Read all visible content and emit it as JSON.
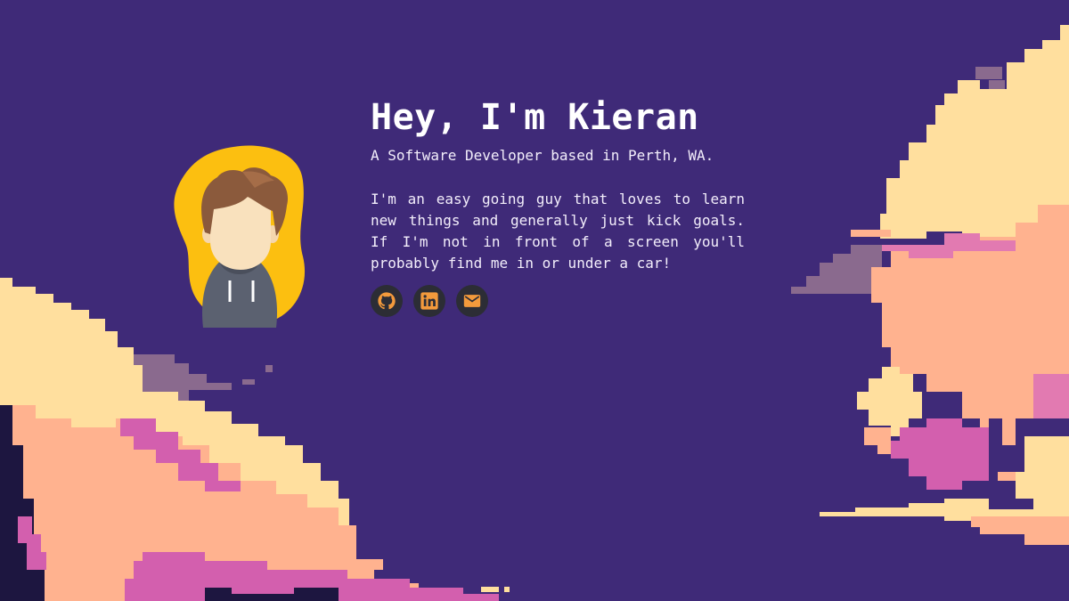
{
  "hero": {
    "title": "Hey, I'm Kieran",
    "subtitle": "A Software Developer based in Perth, WA.",
    "bio": "I'm an easy going guy that loves to learn new things and generally just kick goals. If I'm not in front of a screen you'll probably find me in or under a car!"
  },
  "socials": [
    {
      "name": "github",
      "icon": "github-icon"
    },
    {
      "name": "linkedin",
      "icon": "linkedin-icon"
    },
    {
      "name": "email",
      "icon": "mail-icon"
    }
  ],
  "avatar": {
    "icon": "developer-avatar"
  },
  "colors": {
    "background": "#3f2a78",
    "cloud_light": "#ffdf9e",
    "cloud_peach": "#ffb28f",
    "cloud_pink": "#d35fae",
    "cloud_mauve": "#8a6a8e",
    "social_bg": "#2c2d35",
    "social_icon": "#f39a3c",
    "avatar_blob": "#fcbf10"
  }
}
